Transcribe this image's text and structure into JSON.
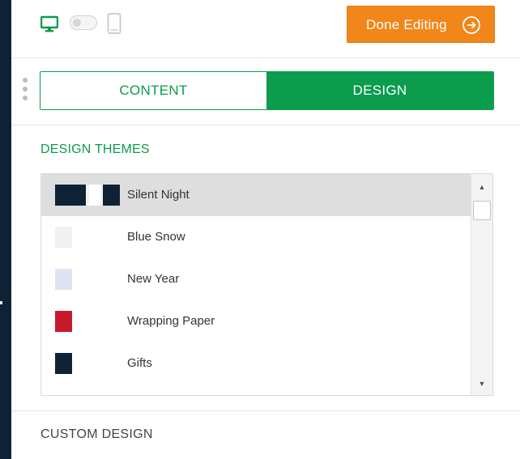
{
  "toolbar": {
    "done_label": "Done Editing",
    "device_icons": [
      "desktop-monitor-icon",
      "view-toggle-icon",
      "mobile-phone-icon"
    ]
  },
  "tabs": [
    {
      "label": "CONTENT",
      "active": false
    },
    {
      "label": "DESIGN",
      "active": true
    }
  ],
  "design_themes": {
    "heading": "DESIGN THEMES",
    "items": [
      {
        "label": "Silent Night",
        "selected": true
      },
      {
        "label": "Blue Snow",
        "selected": false
      },
      {
        "label": "New Year",
        "selected": false
      },
      {
        "label": "Wrapping Paper",
        "selected": false
      },
      {
        "label": "Gifts",
        "selected": false
      },
      {
        "label": "",
        "selected": false
      }
    ]
  },
  "custom_design": {
    "label": "CUSTOM DESIGN"
  },
  "colors": {
    "accent_green": "#0b9c4c",
    "button_orange": "#f1861a",
    "selected_row": "#dedede",
    "navy": "#0e2235"
  }
}
